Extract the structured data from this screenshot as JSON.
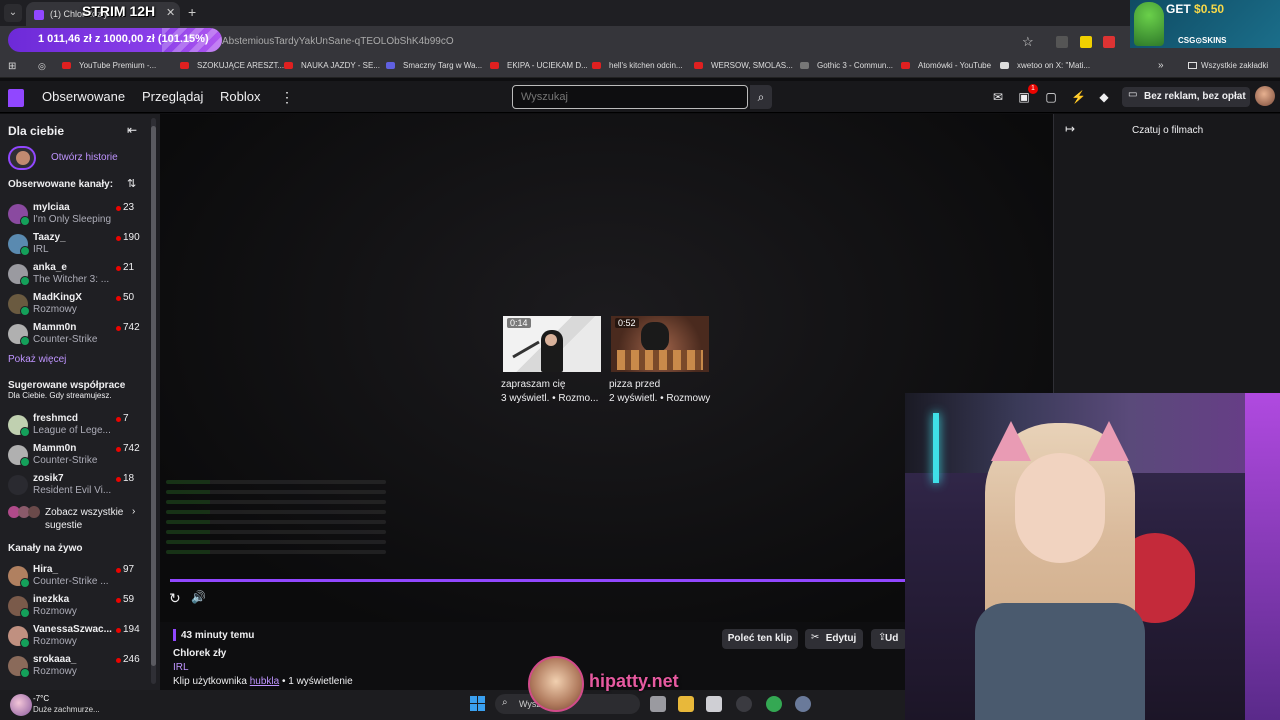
{
  "browser": {
    "tab_title": "(1) Chlorek zły - ...",
    "overlay_title": "STRIM 12H",
    "progress_text": "1 011,46 zł z 1000,00 zł (101.15%)",
    "url": "AbstemiousTardyYakUnSane-qTEOLObShK4b99cO",
    "tab_close": "✕",
    "tab_new": "+",
    "ad": {
      "get": "GET ",
      "amount": "$0.50",
      "brand": "CSG⊙SKINS"
    },
    "bookmarks": [
      "YouTube Premium -...",
      "SZOKUJĄCE ARESZT...",
      "NAUKA JAZDY - SE...",
      "Smaczny Targ w Wa...",
      "EKIPA - UCIEKAM D...",
      "hell's kitchen odcin...",
      "WERSOW, SMOLAS...",
      "Gothic 3 - Commun...",
      "Atomówki - YouTube",
      "xwetoo on X: \"Mati...",
      "Wszystkie zakładki"
    ]
  },
  "topnav": {
    "followed": "Obserwowane",
    "browse": "Przeglądaj",
    "roblox": "Roblox",
    "more": "⋮",
    "search_placeholder": "Wyszukaj",
    "notif_count": "1",
    "turbo": "Bez reklam, bez opłat"
  },
  "sidebar": {
    "for_you": "Dla ciebie",
    "collapse": "⇤",
    "open_history": "Otwórz historie",
    "followed_header": "Obserwowane kanały:",
    "sort": "⇅",
    "followed": [
      {
        "name": "mylciaa",
        "category": "I'm Only Sleeping",
        "viewers": "23"
      },
      {
        "name": "Taazy_",
        "category": "IRL",
        "viewers": "190"
      },
      {
        "name": "anka_e",
        "category": "The Witcher 3: ...",
        "viewers": "21"
      },
      {
        "name": "MadKingX",
        "category": "Rozmowy",
        "viewers": "50"
      },
      {
        "name": "Mamm0n",
        "category": "Counter-Strike",
        "viewers": "742"
      }
    ],
    "show_more": "Pokaż więcej",
    "suggested_header": "Sugerowane współprace",
    "suggested_sub": "Dla Ciebie. Gdy streamujesz.",
    "suggested": [
      {
        "name": "freshmcd",
        "category": "League of Lege...",
        "viewers": "7"
      },
      {
        "name": "Mamm0n",
        "category": "Counter-Strike",
        "viewers": "742"
      },
      {
        "name": "zosik7",
        "category": "Resident Evil Vi...",
        "viewers": "18"
      }
    ],
    "see_all": "Zobacz wszystkie sugestie",
    "live_header": "Kanały na żywo",
    "live": [
      {
        "name": "Hira_",
        "category": "Counter-Strike ...",
        "viewers": "97"
      },
      {
        "name": "inezkka",
        "category": "Rozmowy",
        "viewers": "59"
      },
      {
        "name": "VanessaSzwac...",
        "category": "Rozmowy",
        "viewers": "194"
      },
      {
        "name": "srokaaa_",
        "category": "Rozmowy",
        "viewers": "246"
      }
    ]
  },
  "player": {
    "clips": [
      {
        "duration": "0:14",
        "title": "zapraszam cię",
        "meta": "3 wyświetl. • Rozmo..."
      },
      {
        "duration": "0:52",
        "title": "pizza przed",
        "meta": "2 wyświetl. • Rozmowy"
      }
    ],
    "progress": 1.0
  },
  "clip_info": {
    "time_ago": "43 minuty temu",
    "title": "Chlorek zły",
    "category": "IRL",
    "by_prefix": "Klip użytkownika ",
    "by_user": "hubkla",
    "by_suffix": " • 1 wyświetlenie",
    "recommend": "Poleć ten klip",
    "edit": "Edytuj",
    "share": "Ud"
  },
  "chat_panel": {
    "title": "Czatuj o filmach",
    "collapse": "↦"
  },
  "taskbar": {
    "temp": "-7°C",
    "weather": "Duże zachmurze...",
    "search": "Wysz"
  },
  "watermark": {
    "text": "hipatty.net"
  }
}
